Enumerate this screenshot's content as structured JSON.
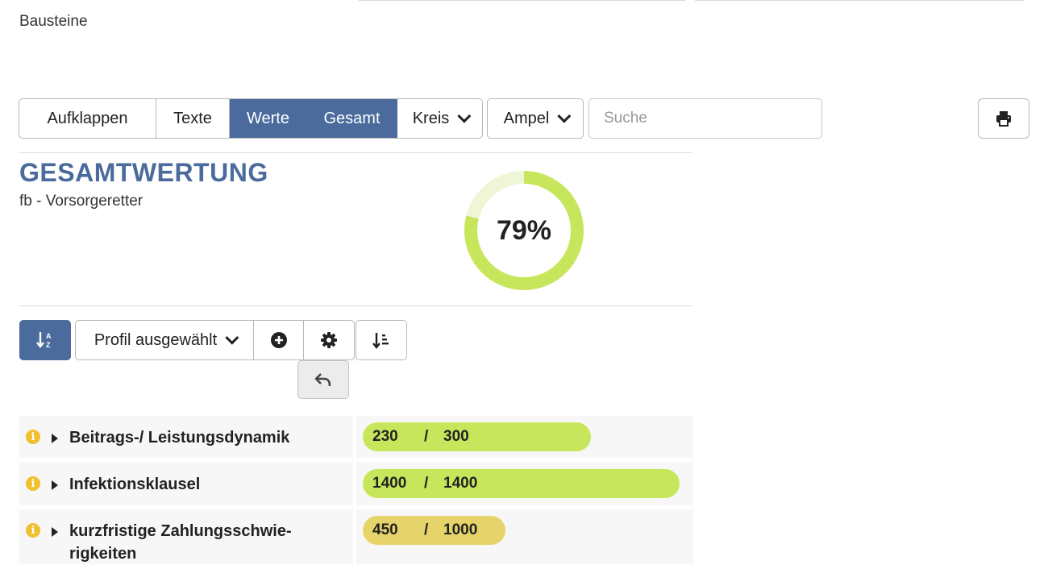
{
  "section_title": "Bausteine",
  "toolbar": {
    "aufklappen": "Aufklappen",
    "texte": "Texte",
    "werte": "Werte",
    "gesamt": "Gesamt",
    "kreis": "Kreis",
    "ampel": "Ampel",
    "search_placeholder": "Suche"
  },
  "summary": {
    "title": "GESAMTWERTUNG",
    "subtitle": "fb - Vorsorgeretter",
    "percent_label": "79%",
    "percent_value": 0.79
  },
  "controls": {
    "profile_label": "Profil ausgewählt"
  },
  "rows": [
    {
      "label": "Beitrags-/ Leistungsdynamik",
      "score": "230",
      "separator": "/",
      "max": "300",
      "fraction": 0.72,
      "color": "#c8e65c"
    },
    {
      "label": "Infektionsklausel",
      "score": "1400",
      "separator": "/",
      "max": "1400",
      "fraction": 1.0,
      "color": "#c8e65c"
    },
    {
      "label_line1": "kurzfristige Zahlungsschwie-",
      "label_line2": "rigkeiten",
      "score": "450",
      "separator": "/",
      "max": "1000",
      "fraction": 0.45,
      "color": "#e6d46a"
    }
  ],
  "colors": {
    "accent": "#4a6b9c",
    "donut_fill": "#c8e65c",
    "donut_track": "#eef6d6",
    "info_icon": "#f0c030"
  }
}
